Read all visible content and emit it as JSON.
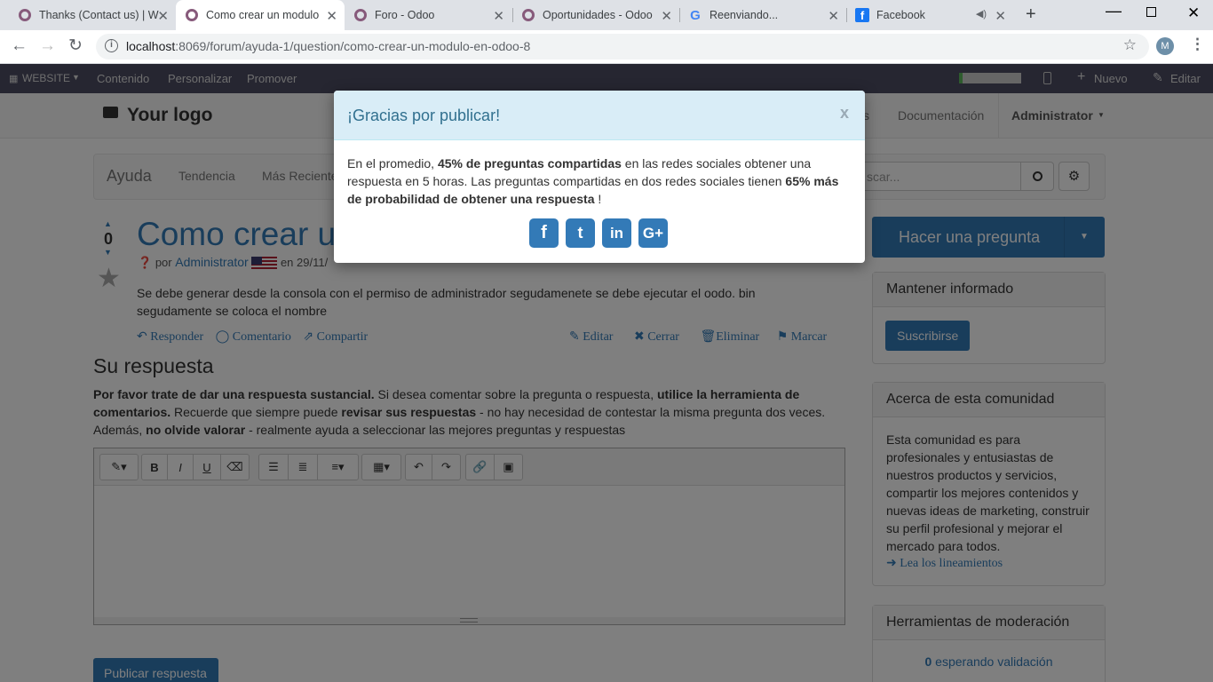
{
  "browser": {
    "tabs": [
      {
        "title": "Thanks (Contact us) | W",
        "icon": "odoo-icon",
        "active": false
      },
      {
        "title": "Como crear un modulo",
        "icon": "odoo-icon",
        "active": true
      },
      {
        "title": "Foro - Odoo",
        "icon": "odoo-icon",
        "active": false
      },
      {
        "title": "Oportunidades - Odoo",
        "icon": "odoo-icon",
        "active": false
      },
      {
        "title": "Reenviando...",
        "icon": "google-icon",
        "active": false
      },
      {
        "title": "Facebook",
        "icon": "facebook-icon",
        "active": false
      }
    ],
    "url_host": "localhost",
    "url_rest": ":8069/forum/ayuda-1/question/como-crear-un-modulo-en-odoo-8",
    "profile_initial": "M"
  },
  "odoo_bar": {
    "website": "WEBSITE",
    "items": [
      "Contenido",
      "Personalizar",
      "Promover"
    ],
    "nuevo": "Nuevo",
    "editar": "Editar"
  },
  "header": {
    "logo": "Your logo",
    "menu_partial": "s",
    "documentation": "Documentación",
    "admin": "Administrator"
  },
  "forum_nav": {
    "title": "Ayuda",
    "items": [
      "Tendencia",
      "Más Reciente"
    ],
    "search_placeholder": "scar..."
  },
  "question": {
    "votes": "0",
    "title": "Como crear u",
    "by": "por",
    "author": "Administrator",
    "date": "en 29/11/",
    "body": "Se  debe generar desde la consola con el permiso  de  administrador  segudamenete se debe ejecutar el  oodo. bin segudamente  se coloca el nombre",
    "actions": [
      "Responder",
      "Comentario",
      "Compartir"
    ],
    "right_actions": [
      "Editar",
      "Cerrar",
      "Eliminar",
      "Marcar"
    ]
  },
  "answer": {
    "heading": "Su respuesta",
    "intro_bold_1": "Por favor trate de dar una respuesta sustancial.",
    "intro_1": " Si desea comentar sobre la pregunta o respuesta, ",
    "intro_bold_2": "utilice la herramienta de comentarios.",
    "intro_2": " Recuerde que siempre puede ",
    "intro_bold_3": "revisar sus respuestas",
    "intro_3": " - no hay necesidad de contestar la misma pregunta dos veces. Además, ",
    "intro_bold_4": "no olvide valorar",
    "intro_4": " - realmente ayuda a seleccionar las mejores preguntas y respuestas",
    "publish": "Publicar respuesta"
  },
  "sidebar": {
    "ask": "Hacer una pregunta",
    "informed_title": "Mantener informado",
    "subscribe": "Suscribirse",
    "about_title": "Acerca de esta comunidad",
    "about_text": "Esta comunidad es para profesionales y entusiastas de nuestros productos y servicios, compartir los mejores contenidos y nuevas ideas de marketing, construir su perfil profesional y mejorar el mercado para todos.",
    "guidelines": "Lea los lineamientos",
    "moderation_title": "Herramientas de moderación",
    "pending_count": "0",
    "pending_text": "esperando validación"
  },
  "modal": {
    "title": "¡Gracias por publicar!",
    "close": "x",
    "t1": "En el promedio, ",
    "b1": "45% de preguntas compartidas",
    "t2": " en las redes sociales obtener una respuesta en 5 horas. Las preguntas compartidas en dos redes sociales tienen ",
    "b2": "65% más de probabilidad de obtener una respuesta",
    "t3": " !",
    "social": [
      "f",
      "t",
      "in",
      "G+"
    ]
  },
  "colors": {
    "accent": "#337ab7",
    "odoo_bar": "#4c4c63",
    "modal_header": "#d9edf7"
  }
}
